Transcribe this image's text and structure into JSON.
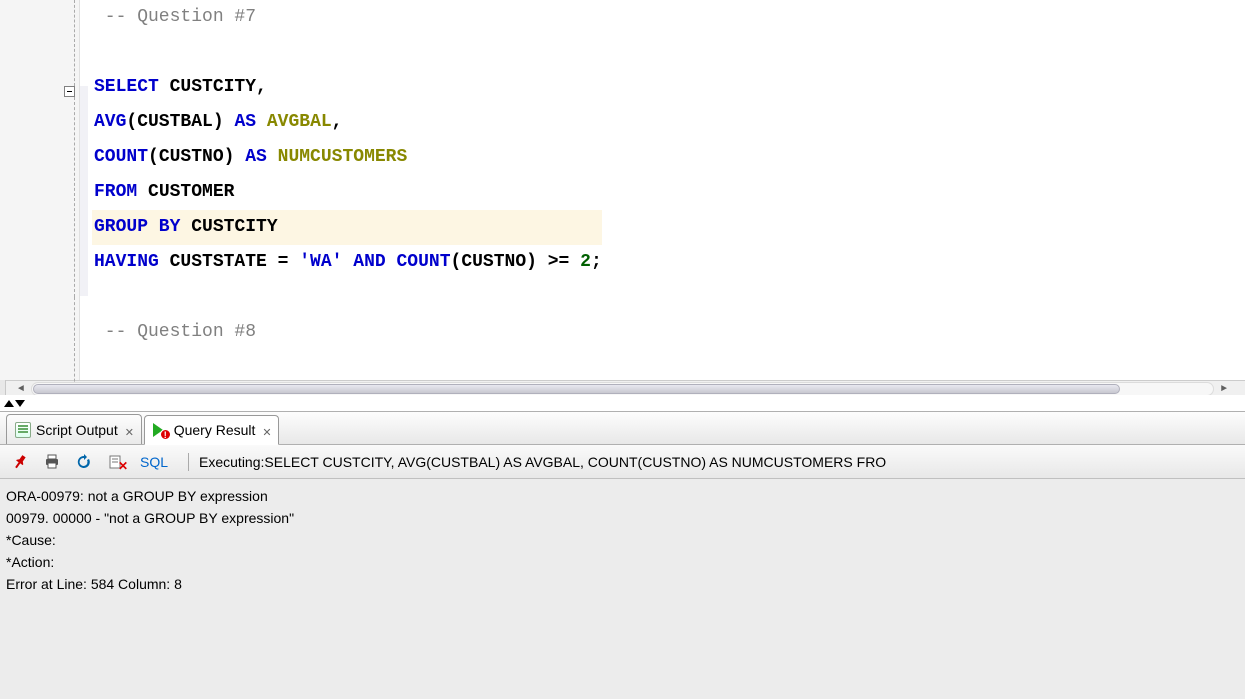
{
  "editor": {
    "lines": [
      {
        "type": "comment",
        "text": "-- Question #7"
      },
      {
        "type": "blank",
        "text": ""
      },
      {
        "type": "sql",
        "tokens": [
          {
            "t": "kw",
            "v": "SELECT"
          },
          {
            "t": "sp",
            "v": " "
          },
          {
            "t": "ident",
            "v": "CUSTCITY,"
          }
        ],
        "fold": true
      },
      {
        "type": "sql",
        "tokens": [
          {
            "t": "kw",
            "v": "AVG"
          },
          {
            "t": "ident",
            "v": "(CUSTBAL) "
          },
          {
            "t": "kw",
            "v": "AS"
          },
          {
            "t": "sp",
            "v": " "
          },
          {
            "t": "func",
            "v": "AVGBAL"
          },
          {
            "t": "ident",
            "v": ","
          }
        ]
      },
      {
        "type": "sql",
        "tokens": [
          {
            "t": "kw",
            "v": "COUNT"
          },
          {
            "t": "ident",
            "v": "(CUSTNO) "
          },
          {
            "t": "kw",
            "v": "AS"
          },
          {
            "t": "sp",
            "v": " "
          },
          {
            "t": "func",
            "v": "NUMCUSTOMERS"
          }
        ]
      },
      {
        "type": "sql",
        "tokens": [
          {
            "t": "kw",
            "v": "FROM"
          },
          {
            "t": "sp",
            "v": " "
          },
          {
            "t": "ident",
            "v": "CUSTOMER"
          }
        ]
      },
      {
        "type": "sql",
        "hl": true,
        "tokens": [
          {
            "t": "kw",
            "v": "GROUP BY"
          },
          {
            "t": "sp",
            "v": " "
          },
          {
            "t": "ident",
            "v": "CUSTCITY"
          }
        ]
      },
      {
        "type": "sql",
        "tokens": [
          {
            "t": "kw",
            "v": "HAVING"
          },
          {
            "t": "sp",
            "v": " "
          },
          {
            "t": "ident",
            "v": "CUSTSTATE = "
          },
          {
            "t": "str",
            "v": "'WA'"
          },
          {
            "t": "sp",
            "v": " "
          },
          {
            "t": "kw",
            "v": "AND"
          },
          {
            "t": "sp",
            "v": " "
          },
          {
            "t": "kw",
            "v": "COUNT"
          },
          {
            "t": "ident",
            "v": "(CUSTNO) >= "
          },
          {
            "t": "num",
            "v": "2"
          },
          {
            "t": "ident",
            "v": ";"
          }
        ]
      },
      {
        "type": "blank",
        "text": ""
      },
      {
        "type": "comment",
        "text": "-- Question #8"
      }
    ]
  },
  "tabs": {
    "script_output": "Script Output",
    "query_result": "Query Result"
  },
  "toolbar": {
    "sql_label": "SQL",
    "executing": "Executing:SELECT CUSTCITY, AVG(CUSTBAL) AS AVGBAL, COUNT(CUSTNO) AS NUMCUSTOMERS FRO"
  },
  "output": {
    "line1": "ORA-00979: not a GROUP BY expression",
    "line2": "00979. 00000 -  \"not a GROUP BY expression\"",
    "line3": "*Cause:",
    "line4": "*Action:",
    "line5": "Error at Line: 584 Column: 8"
  }
}
